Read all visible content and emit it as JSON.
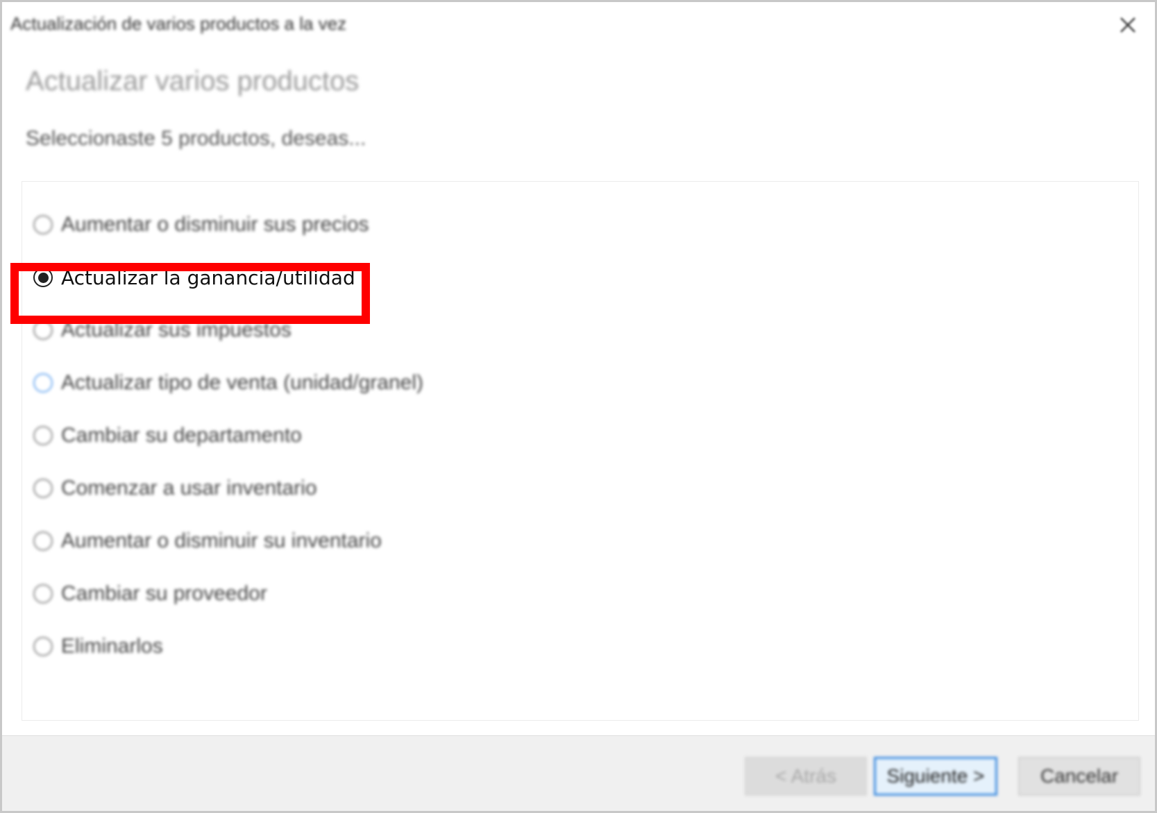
{
  "window": {
    "title": "Actualización de varios productos a la vez"
  },
  "page": {
    "heading": "Actualizar varios productos",
    "subheading": "Seleccionaste 5 productos, deseas..."
  },
  "options": [
    {
      "label": "Aumentar o disminuir sus precios",
      "selected": false
    },
    {
      "label": "Actualizar la ganancia/utilidad",
      "selected": true
    },
    {
      "label": "Actualizar sus impuestos",
      "selected": false
    },
    {
      "label": "Actualizar tipo de venta (unidad/granel)",
      "selected": false
    },
    {
      "label": "Cambiar su departamento",
      "selected": false
    },
    {
      "label": "Comenzar a usar inventario",
      "selected": false
    },
    {
      "label": "Aumentar o disminuir su inventario",
      "selected": false
    },
    {
      "label": "Cambiar su proveedor",
      "selected": false
    },
    {
      "label": "Eliminarlos",
      "selected": false
    }
  ],
  "footer": {
    "back_label": "< Atrás",
    "next_label": "Siguiente >",
    "cancel_label": "Cancelar"
  },
  "icons": {
    "close": "close-icon",
    "highlight": "red-highlight-annotation"
  },
  "colors": {
    "highlight": "#ff0000",
    "focus_accent": "#3c8be0"
  }
}
